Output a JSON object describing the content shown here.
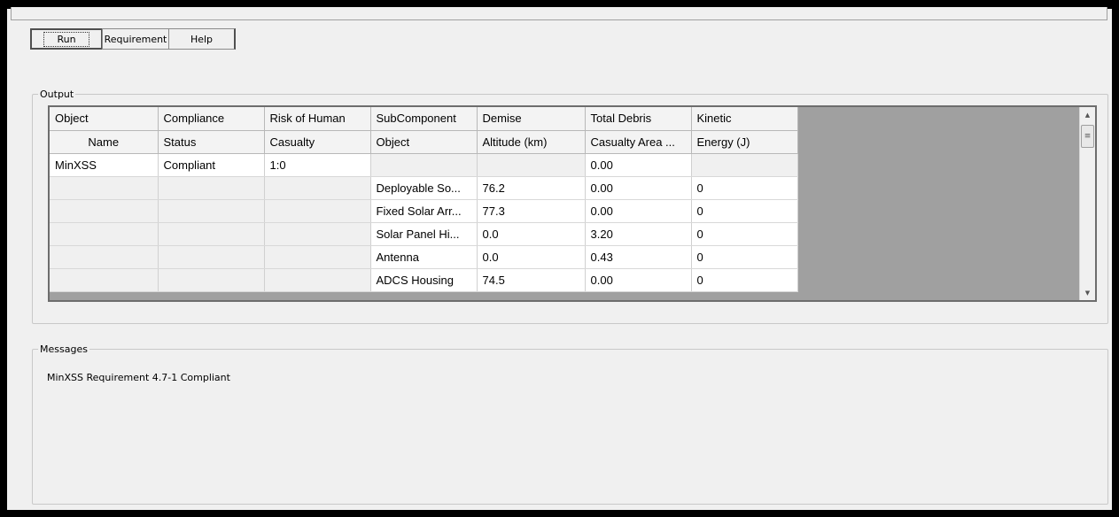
{
  "toolbar": {
    "run_label": "Run",
    "requirement_label": "Requirement",
    "help_label": "Help"
  },
  "output": {
    "title": "Output",
    "columns": [
      [
        "Object",
        "Name"
      ],
      [
        "Compliance",
        "Status"
      ],
      [
        "Risk of Human",
        "Casualty"
      ],
      [
        "SubComponent",
        "Object"
      ],
      [
        "Demise",
        "Altitude (km)"
      ],
      [
        "Total Debris",
        "Casualty Area ..."
      ],
      [
        "Kinetic",
        "Energy (J)"
      ]
    ],
    "rows": [
      [
        "MinXSS",
        "Compliant",
        "1:0",
        "",
        "",
        "0.00",
        ""
      ],
      [
        "",
        "",
        "",
        "Deployable So...",
        "76.2",
        "0.00",
        "0"
      ],
      [
        "",
        "",
        "",
        "Fixed Solar Arr...",
        "77.3",
        "0.00",
        "0"
      ],
      [
        "",
        "",
        "",
        "Solar Panel Hi...",
        "0.0",
        "3.20",
        "0"
      ],
      [
        "",
        "",
        "",
        "Antenna",
        "0.0",
        "0.43",
        "0"
      ],
      [
        "",
        "",
        "",
        "ADCS Housing",
        "74.5",
        "0.00",
        "0"
      ]
    ]
  },
  "messages": {
    "title": "Messages",
    "text": "MinXSS Requirement 4.7-1 Compliant"
  }
}
